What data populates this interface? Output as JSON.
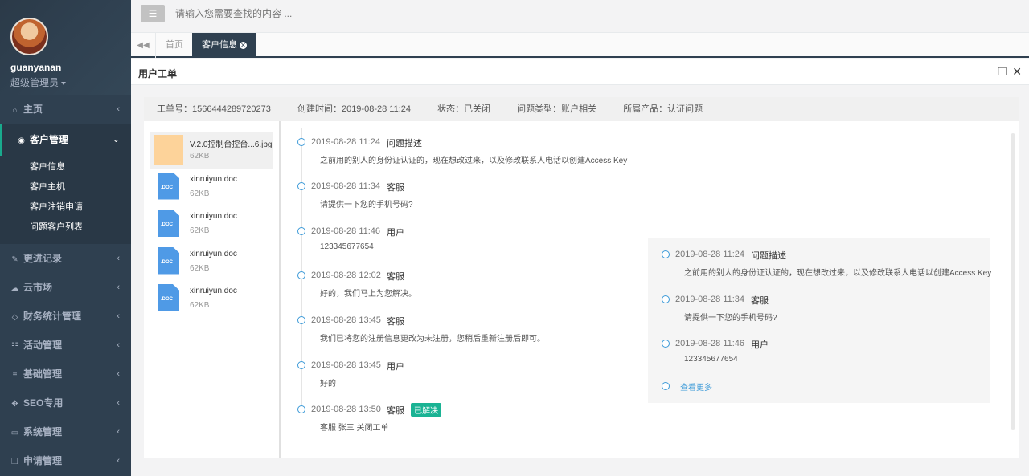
{
  "user": {
    "name": "guanyanan",
    "role": "超级管理员"
  },
  "topbar": {
    "search_placeholder": "请输入您需要查找的内容 ..."
  },
  "tabs": {
    "home": "首页",
    "active": "客户信息"
  },
  "nav": {
    "home": "主页",
    "customer": "客户管理",
    "customer_sub": [
      "客户信息",
      "客户主机",
      "客户注销申请",
      "问题客户列表"
    ],
    "items": [
      "更进记录",
      "云市场",
      "财务统计管理",
      "活动管理",
      "基础管理",
      "SEO专用",
      "系统管理",
      "申请管理"
    ]
  },
  "panel": {
    "title": "用户工单"
  },
  "info": {
    "ticket": "工单号：1566444289720273",
    "created": "创建时间：2019-08-28 11:24",
    "status": "状态：已关闭",
    "type": "问题类型：账户相关",
    "product": "所属产品：认证问题"
  },
  "files": [
    {
      "name": "V.2.0控制台控台...6.jpg",
      "size": "62KB",
      "kind": "image"
    },
    {
      "name": "xinruiyun.doc",
      "size": "62KB",
      "kind": "doc"
    },
    {
      "name": "xinruiyun.doc",
      "size": "62KB",
      "kind": "doc"
    },
    {
      "name": "xinruiyun.doc",
      "size": "62KB",
      "kind": "doc"
    },
    {
      "name": "xinruiyun.doc",
      "size": "62KB",
      "kind": "doc"
    }
  ],
  "doc_label": ".DOC",
  "timeline": [
    {
      "time": "2019-08-28 11:24",
      "who": "问题描述",
      "msg": "之前用的别人的身份证认证的，现在想改过来，以及修改联系人电话以创建Access Key"
    },
    {
      "time": "2019-08-28 11:34",
      "who": "客服",
      "msg": "请提供一下您的手机号码?"
    },
    {
      "time": "2019-08-28 11:46",
      "who": "用户",
      "msg": "123345677654"
    },
    {
      "time": "2019-08-28 12:02",
      "who": "客服",
      "msg": "好的，我们马上为您解决。"
    },
    {
      "time": "2019-08-28 13:45",
      "who": "客服",
      "msg": "我们已将您的注册信息更改为未注册，您稍后重新注册后即可。"
    },
    {
      "time": "2019-08-28 13:45",
      "who": "用户",
      "msg": "好的"
    },
    {
      "time": "2019-08-28 13:50",
      "who": "客服",
      "msg": "客服 张三 关闭工单",
      "badge": "已解决"
    }
  ],
  "popover": {
    "items": [
      {
        "time": "2019-08-28 11:24",
        "who": "问题描述",
        "msg": "之前用的别人的身份证认证的，现在想改过来，以及修改联系人电话以创建Access Key"
      },
      {
        "time": "2019-08-28 11:34",
        "who": "客服",
        "msg": "请提供一下您的手机号码?"
      },
      {
        "time": "2019-08-28 11:46",
        "who": "用户",
        "msg": "123345677654"
      }
    ],
    "more": "查看更多"
  },
  "icons": {
    "menu": "menu-icon",
    "home": "home-icon",
    "eye": "eye-icon",
    "edit": "edit-icon",
    "cloud": "cloud-icon",
    "diamond": "diamond-icon",
    "sliders": "sliders-icon",
    "list": "list-icon",
    "paw": "paw-icon",
    "desktop": "desktop-icon",
    "copy": "copy-icon",
    "back": "double-left-icon",
    "close": "close-icon",
    "restore": "restore-icon"
  }
}
